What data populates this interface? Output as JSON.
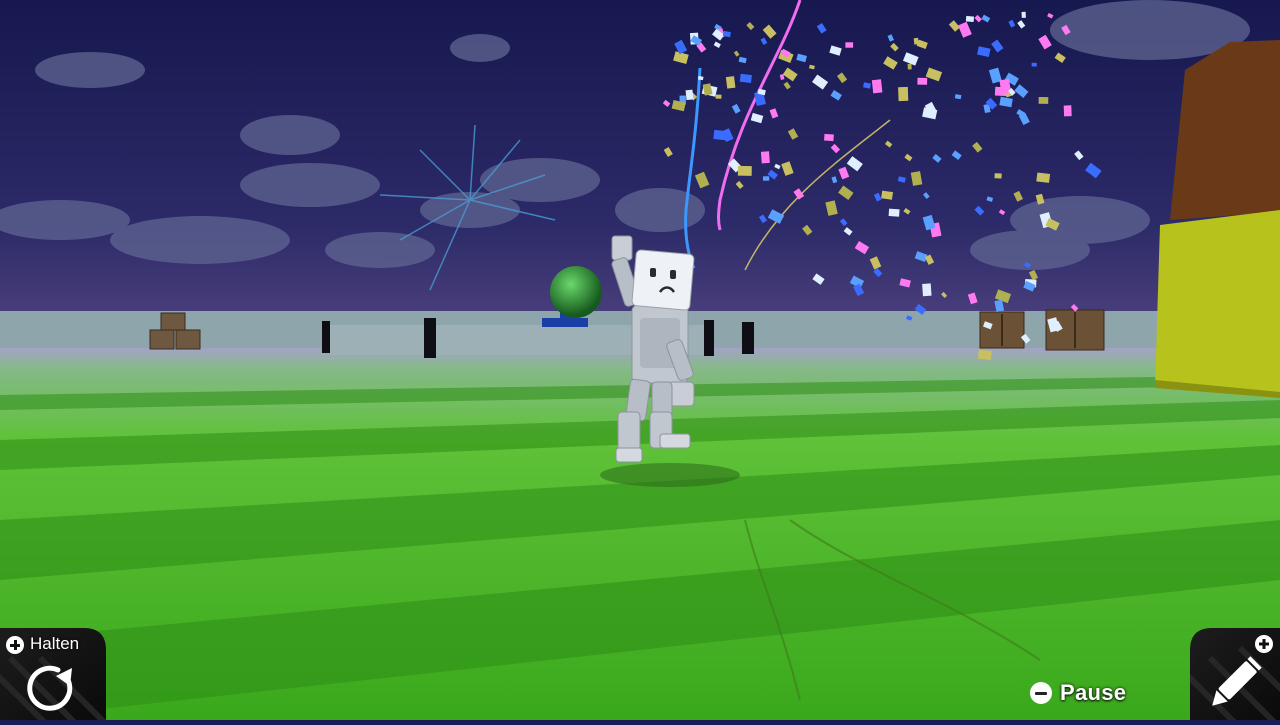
{
  "hud": {
    "hold_label": "Halten",
    "pause_label": "Pause"
  },
  "colors": {
    "sky_top": "#1a1a55",
    "sky_bottom": "#3a3270",
    "grass_light": "#6ed12a",
    "grass_dark": "#2f9a16",
    "wall": "#8fa7ad",
    "robot": "#c9ced6",
    "confetti": [
      "#5aa0ff",
      "#ff7af0",
      "#c8c060",
      "#dfefff",
      "#3a6cff",
      "#b0b050"
    ],
    "block_yellow": "#b8c21d",
    "block_brown": "#6a3a18"
  },
  "icons": {
    "hold": "plus-button-icon",
    "rotate": "rotate-icon",
    "pause": "minus-button-icon",
    "edit": "pencil-icon"
  }
}
